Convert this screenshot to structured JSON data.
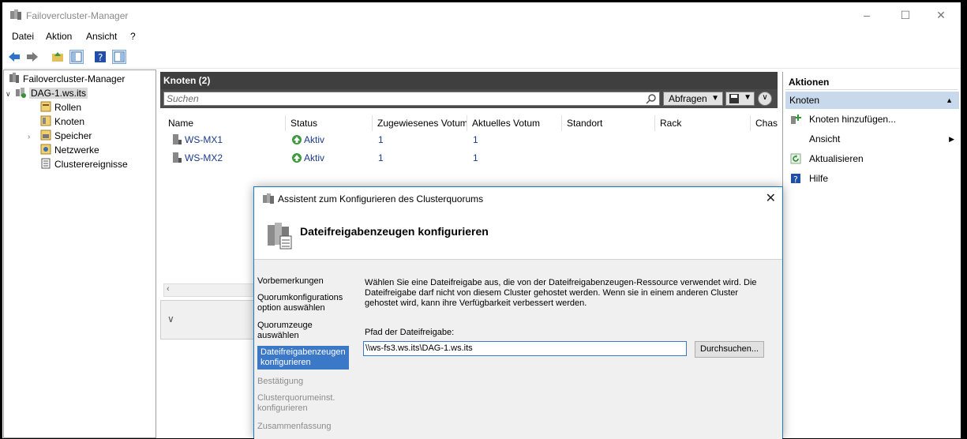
{
  "window": {
    "title": "Failovercluster-Manager",
    "minimize": "–",
    "maximize": "☐",
    "close": "✕"
  },
  "menu": [
    "Datei",
    "Aktion",
    "Ansicht",
    "?"
  ],
  "tree": {
    "root": "Failovercluster-Manager",
    "cluster": "DAG-1.ws.its",
    "children": [
      "Rollen",
      "Knoten",
      "Speicher",
      "Netzwerke",
      "Clusterereignisse"
    ]
  },
  "center": {
    "title": "Knoten (2)",
    "search_placeholder": "Suchen",
    "query_label": "Abfragen",
    "columns": [
      "Name",
      "Status",
      "Zugewiesenes Votum",
      "Aktuelles Votum",
      "Standort",
      "Rack",
      "Chass"
    ],
    "rows": [
      {
        "name": "WS-MX1",
        "status": "Aktiv",
        "assigned": "1",
        "current": "1"
      },
      {
        "name": "WS-MX2",
        "status": "Aktiv",
        "assigned": "1",
        "current": "1"
      }
    ]
  },
  "actions": {
    "title": "Aktionen",
    "section": "Knoten",
    "items": [
      "Knoten hinzufügen...",
      "Ansicht",
      "Aktualisieren",
      "Hilfe"
    ]
  },
  "wizard": {
    "title": "Assistent zum Konfigurieren des Clusterquorums",
    "heading": "Dateifreigabenzeugen konfigurieren",
    "steps": [
      {
        "label": "Vorbemerkungen",
        "state": "done"
      },
      {
        "label": "Quorumkonfigurations option auswählen",
        "state": "done"
      },
      {
        "label": "Quorumzeuge auswählen",
        "state": "done"
      },
      {
        "label": "Dateifreigabenzeugen konfigurieren",
        "state": "active"
      },
      {
        "label": "Bestätigung",
        "state": "todo"
      },
      {
        "label": "Clusterquorumeinst. konfigurieren",
        "state": "todo"
      },
      {
        "label": "Zusammenfassung",
        "state": "todo"
      }
    ],
    "description": "Wählen Sie eine Dateifreigabe aus, die von der Dateifreigabenzeugen-Ressource verwendet wird. Die Dateifreigabe darf nicht von diesem Cluster gehostet werden. Wenn sie in einem anderen Cluster gehostet wird, kann ihre Verfügbarkeit verbessert werden.",
    "path_label": "Pfad der Dateifreigabe:",
    "path_value": "\\\\ws-fs3.ws.its\\DAG-1.ws.its",
    "browse_label": "Durchsuchen..."
  }
}
